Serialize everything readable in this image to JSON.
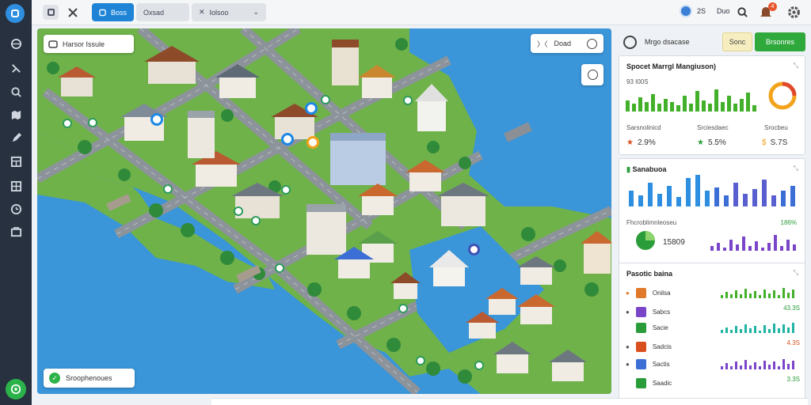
{
  "topbar": {
    "tabs": [
      {
        "label": "Boss",
        "active": true
      },
      {
        "label": "Oxsad",
        "active": false
      },
      {
        "label": "Iolsoo",
        "active": false
      }
    ],
    "user_count": "2S",
    "user_label": "Duo"
  },
  "map": {
    "search_label": "Harsor Issule",
    "layers_label": "Doad",
    "status_label": "Sroophenoues"
  },
  "panel": {
    "title": "Mrgo dsacase",
    "btn_secondary": "Sonc",
    "btn_primary": "Brsonres",
    "card1": {
      "title": "Spocet Marrgl Mangiuson)",
      "subtitle": "93 I00S",
      "stats": [
        {
          "label": "Sarsnolinicd",
          "value": "2.9%",
          "icon": "star-icon",
          "color": "#d9501e"
        },
        {
          "label": "Srciesdaec",
          "value": "5.5%",
          "icon": "star-icon",
          "color": "#2a9d3a"
        },
        {
          "label": "Srocbeu",
          "value": "S.7S",
          "icon": "money-icon",
          "color": "#f2a31b"
        }
      ]
    },
    "card2": {
      "title": "Sanabuoa",
      "subtitle": "Fhcroblimnleoseu",
      "small_right": "186%",
      "metric_value": "15809"
    },
    "card3": {
      "title": "Pasotic baina",
      "rows": [
        {
          "label": "Onilsa",
          "value": "",
          "color": "#e07a2a"
        },
        {
          "label": "Sabcs",
          "value": "43.3S",
          "color": "#7b45c9"
        },
        {
          "label": "Sacie",
          "value": "",
          "color": "#2a9d3a"
        },
        {
          "label": "Sadcis",
          "value": "4.3S",
          "color": "#d9501e"
        },
        {
          "label": "Sactis",
          "value": "",
          "color": "#3b6fd6"
        },
        {
          "label": "Saadic",
          "value": "3.3S",
          "color": "#2a9d3a"
        }
      ]
    }
  },
  "colors": {
    "accent": "#1f84d6",
    "primary_green": "#2fa83c",
    "water": "#3a95d9",
    "rail": "#27313f"
  }
}
